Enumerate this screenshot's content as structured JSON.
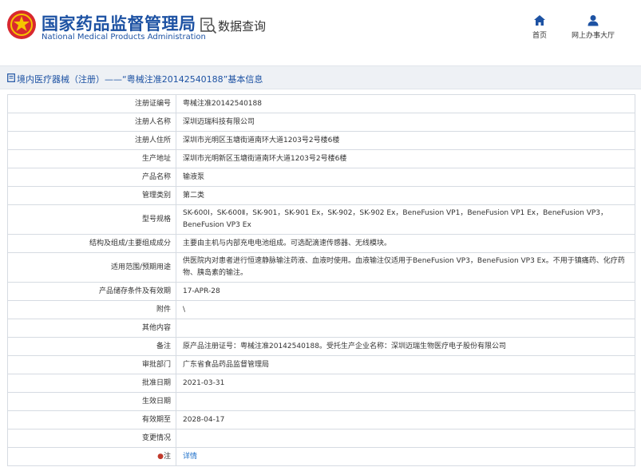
{
  "header": {
    "site_title": "国家药品监督管理局",
    "site_subtitle": "National Medical Products Administration",
    "page_heading": "数据查询",
    "nav": [
      {
        "label": "首页",
        "icon": "home-icon"
      },
      {
        "label": "网上办事大厅",
        "icon": "user-icon"
      }
    ]
  },
  "title_bar": {
    "text": "境内医疗器械（注册）——“粤械注准20142540188”基本信息",
    "icon": "document-icon"
  },
  "colors": {
    "brand_blue": "#1d52a3",
    "link_blue": "#1d6fc9",
    "title_bar_bg": "#eef1f5",
    "border": "#d6dbe2"
  },
  "rows": [
    {
      "label": "注册证编号",
      "value": "粤械注准20142540188"
    },
    {
      "label": "注册人名称",
      "value": "深圳迈瑞科技有限公司"
    },
    {
      "label": "注册人住所",
      "value": "深圳市光明区玉塘街道南环大道1203号2号楼6楼"
    },
    {
      "label": "生产地址",
      "value": "深圳市光明新区玉塘街道南环大道1203号2号楼6楼"
    },
    {
      "label": "产品名称",
      "value": "输液泵"
    },
    {
      "label": "管理类别",
      "value": "第二类"
    },
    {
      "label": "型号规格",
      "value": "SK-600Ⅰ，SK-600Ⅱ，SK-901，SK-901 Ex，SK-902，SK-902 Ex，BeneFusion VP1，BeneFusion VP1 Ex，BeneFusion VP3，BeneFusion VP3 Ex"
    },
    {
      "label": "结构及组成/主要组成成分",
      "value": "主要由主机与内部充电电池组成。可选配滴速传感器、无线模块。"
    },
    {
      "label": "适用范围/预期用途",
      "value": "供医院内对患者进行恒速静脉输注药液、血液时使用。血液输注仅适用于BeneFusion VP3，BeneFusion VP3 Ex。不用于镇痛药、化疗药物、胰岛素的输注。"
    },
    {
      "label": "产品储存条件及有效期",
      "value": "17-APR-28"
    },
    {
      "label": "附件",
      "value": "\\"
    },
    {
      "label": "其他内容",
      "value": ""
    },
    {
      "label": "备注",
      "value": "原产品注册证号：粤械注准20142540188。受托生产企业名称：深圳迈瑞生物医疗电子股份有限公司"
    },
    {
      "label": "审批部门",
      "value": "广东省食品药品监督管理局"
    },
    {
      "label": "批准日期",
      "value": "2021-03-31"
    },
    {
      "label": "生效日期",
      "value": ""
    },
    {
      "label": "有效期至",
      "value": "2028-04-17"
    },
    {
      "label": "变更情况",
      "value": ""
    },
    {
      "label": "注",
      "value": "详情",
      "icon": "pin-icon"
    }
  ]
}
